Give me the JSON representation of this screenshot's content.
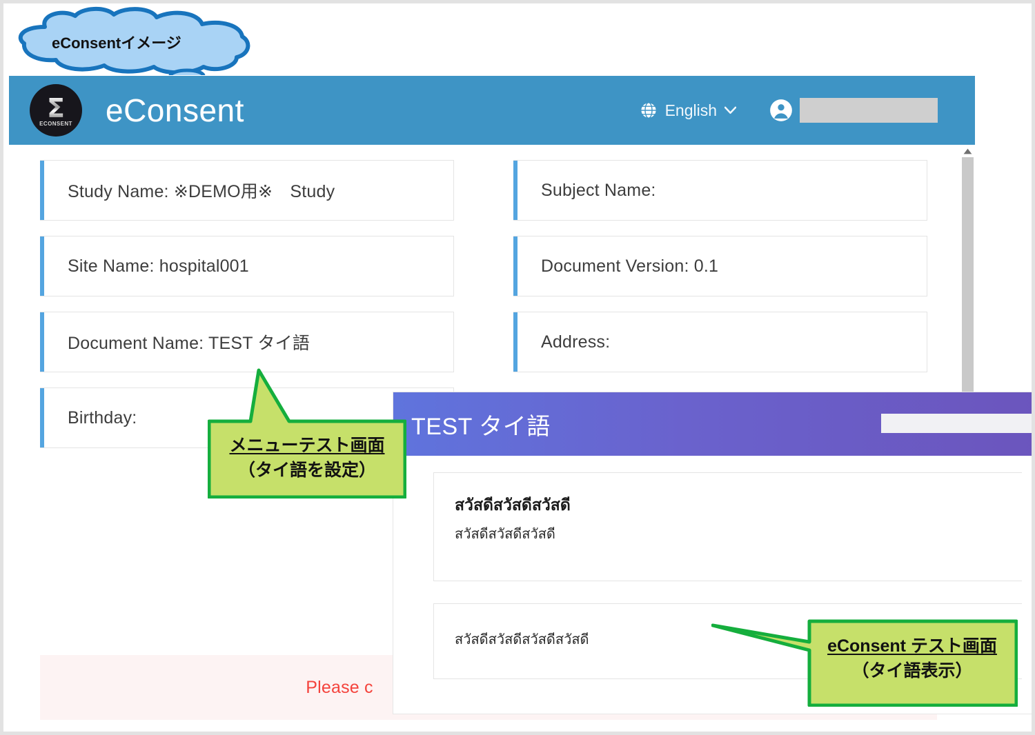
{
  "cloud_callout": {
    "label": "eConsentイメージ",
    "fill_color": "#a9d3f5",
    "stroke_color": "#1874bd"
  },
  "app": {
    "header": {
      "title": "eConsent",
      "logo_sigma": "Σ",
      "logo_wordmark": "ECONSENT",
      "logo_icon": "sigma-logo-icon",
      "background_color": "#3e94c5",
      "language": {
        "icon": "globe-icon",
        "label": "English",
        "caret_icon": "chevron-down-icon"
      },
      "account": {
        "icon": "user-circle-icon",
        "name_redacted": ""
      }
    },
    "info_cards": [
      {
        "label": "Study Name: ※DEMO用※　Study"
      },
      {
        "label": "Subject Name:"
      },
      {
        "label": "Site Name: hospital001"
      },
      {
        "label": "Document Version: 0.1"
      },
      {
        "label": "Document Name: TEST タイ語"
      },
      {
        "label": "Address:"
      },
      {
        "label": "Birthday:"
      }
    ],
    "alert": {
      "text": "Please c",
      "text_color": "#f4433c",
      "background_color": "#fdf3f3"
    },
    "scrollbar": {
      "up_arrow_icon": "caret-up-icon",
      "thumb_color": "#c9c9c9"
    },
    "accent_color": "#54a5e0"
  },
  "dialog": {
    "title": "TEST タイ語",
    "header_gradient_start": "#5f74dd",
    "header_gradient_end": "#6b55bd",
    "header_field_redacted": "",
    "panels": [
      {
        "heading": "สวัสดีสวัสดีสวัสดี",
        "body": "สวัสดีสวัสดีสวัสดี"
      },
      {
        "heading": "",
        "body": "สวัสดีสวัสดีสวัสดีสวัสดี"
      }
    ]
  },
  "callouts": {
    "menu_test": {
      "line1": "メニューテスト画面",
      "line2": "（タイ語を設定）",
      "fill_color": "#c6e06a",
      "stroke_color": "#15ae3d"
    },
    "econsent_test": {
      "line1": "eConsent テスト画面",
      "line2": "（タイ語表示）",
      "fill_color": "#c6e06a",
      "stroke_color": "#15ae3d"
    }
  }
}
